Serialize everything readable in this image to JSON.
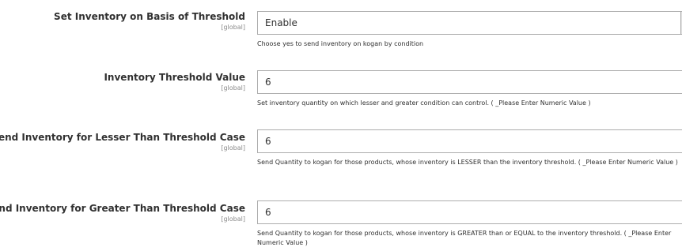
{
  "fields": [
    {
      "label": "Set Inventory on Basis of Threshold",
      "scope": "[global]",
      "value": "Enable",
      "note": "Choose yes to send inventory on kogan by condition"
    },
    {
      "label": "Inventory Threshold Value",
      "scope": "[global]",
      "value": "6",
      "note": "Set inventory quantity on which lesser and greater condition can control. ( _Please Enter Numeric Value )"
    },
    {
      "label": "Send Inventory for Lesser Than Threshold Case",
      "scope": "[global]",
      "value": "6",
      "note": "Send Quantity to kogan for those products, whose inventory is LESSER than the inventory threshold. ( _Please Enter Numeric Value )"
    },
    {
      "label": "Send Inventory for Greater Than Threshold Case",
      "scope": "[global]",
      "value": "6",
      "note": "Send Quantity to kogan for those products, whose inventory is GREATER than or EQUAL to the inventory threshold. ( _Please Enter Numeric Value )"
    }
  ],
  "icons": {
    "select_arrow": "chevron-down-icon"
  }
}
